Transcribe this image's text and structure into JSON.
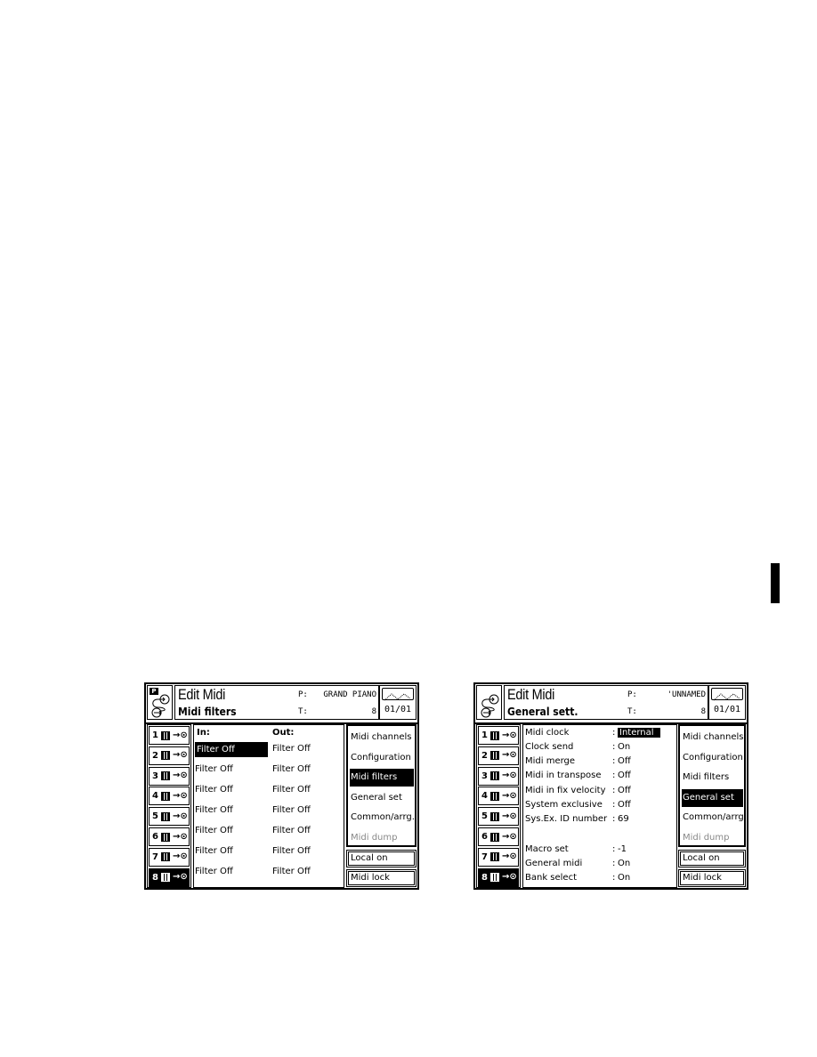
{
  "screens": [
    {
      "header": {
        "title": "Edit Midi",
        "subtitle": "Midi filters",
        "p_label": "P:",
        "p_value": "GRAND PIANO",
        "t_label": "T:",
        "t_value": "8",
        "page": "01/01",
        "badge": "P"
      },
      "tracks": [
        {
          "num": "1"
        },
        {
          "num": "2"
        },
        {
          "num": "3"
        },
        {
          "num": "4"
        },
        {
          "num": "5"
        },
        {
          "num": "6"
        },
        {
          "num": "7"
        },
        {
          "num": "8",
          "selected": true
        }
      ],
      "filters": {
        "in_header": "In:",
        "out_header": "Out:",
        "rows": [
          {
            "in": "Filter Off",
            "out": "Filter Off"
          },
          {
            "in": "Filter Off",
            "out": "Filter Off"
          },
          {
            "in": "Filter Off",
            "out": "Filter Off"
          },
          {
            "in": "Filter Off",
            "out": "Filter Off"
          },
          {
            "in": "Filter Off",
            "out": "Filter Off"
          },
          {
            "in": "Filter Off",
            "out": "Filter Off"
          },
          {
            "in": "Filter Off",
            "out": "Filter Off"
          }
        ]
      },
      "menu": [
        {
          "label": "Midi channels"
        },
        {
          "label": "Configuration"
        },
        {
          "label": "Midi filters",
          "selected": true
        },
        {
          "label": "General set"
        },
        {
          "label": "Common/arrg."
        },
        {
          "label": "Midi dump",
          "disabled": true
        }
      ],
      "buttons": {
        "local": "Local on",
        "lock": "Midi lock"
      }
    },
    {
      "header": {
        "title": "Edit Midi",
        "subtitle": "General sett.",
        "p_label": "P:",
        "p_value": "'UNNAMED",
        "t_label": "T:",
        "t_value": "8",
        "page": "01/01"
      },
      "tracks": [
        {
          "num": "1"
        },
        {
          "num": "2"
        },
        {
          "num": "3"
        },
        {
          "num": "4"
        },
        {
          "num": "5"
        },
        {
          "num": "6"
        },
        {
          "num": "7"
        },
        {
          "num": "8",
          "selected": true
        }
      ],
      "settings": [
        {
          "label": "Midi clock",
          "value": "Internal",
          "selected": true
        },
        {
          "label": "Clock send",
          "value": "On"
        },
        {
          "label": "Midi merge",
          "value": "Off"
        },
        {
          "label": "Midi in transpose",
          "value": "Off"
        },
        {
          "label": "Midi in fix velocity",
          "value": "Off"
        },
        {
          "label": "System exclusive",
          "value": "Off"
        },
        {
          "label": "Sys.Ex. ID number",
          "value": "69"
        },
        {
          "label": "Macro set",
          "value": "-1"
        },
        {
          "label": "General midi",
          "value": "On"
        },
        {
          "label": "Bank select",
          "value": "On"
        }
      ],
      "separator": ":",
      "menu": [
        {
          "label": "Midi channels"
        },
        {
          "label": "Configuration"
        },
        {
          "label": "Midi filters"
        },
        {
          "label": "General set",
          "selected": true
        },
        {
          "label": "Common/arrg."
        },
        {
          "label": "Midi dump",
          "disabled": true
        }
      ],
      "buttons": {
        "local": "Local on",
        "lock": "Midi lock"
      }
    }
  ]
}
